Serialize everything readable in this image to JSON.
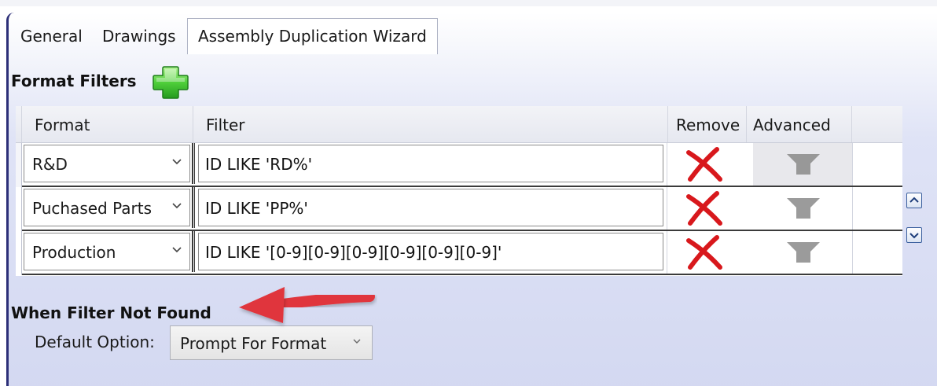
{
  "tabs": [
    {
      "label": "General",
      "active": false
    },
    {
      "label": "Drawings",
      "active": false
    },
    {
      "label": "Assembly Duplication Wizard",
      "active": true
    }
  ],
  "format_filters": {
    "title": "Format Filters",
    "add_icon": "green-plus-icon",
    "columns": {
      "format": "Format",
      "filter": "Filter",
      "remove": "Remove",
      "advanced": "Advanced"
    },
    "rows": [
      {
        "format": "R&D",
        "filter": "ID LIKE 'RD%'",
        "remove_icon": "red-x-icon",
        "advanced_icon": "funnel-icon"
      },
      {
        "format": "Puchased Parts",
        "filter": "ID LIKE 'PP%'",
        "remove_icon": "red-x-icon",
        "advanced_icon": "funnel-icon"
      },
      {
        "format": "Production",
        "filter": "ID LIKE '[0-9][0-9][0-9][0-9][0-9][0-9]'",
        "remove_icon": "red-x-icon",
        "advanced_icon": "funnel-icon"
      }
    ]
  },
  "not_found": {
    "title": "When Filter Not Found",
    "default_label": "Default Option:",
    "default_value": "Prompt For Format"
  },
  "colors": {
    "accent_arrow": "#e0343c",
    "panel_border": "#2c2f78",
    "add_green": "#3db83a",
    "remove_red": "#d8181c"
  }
}
